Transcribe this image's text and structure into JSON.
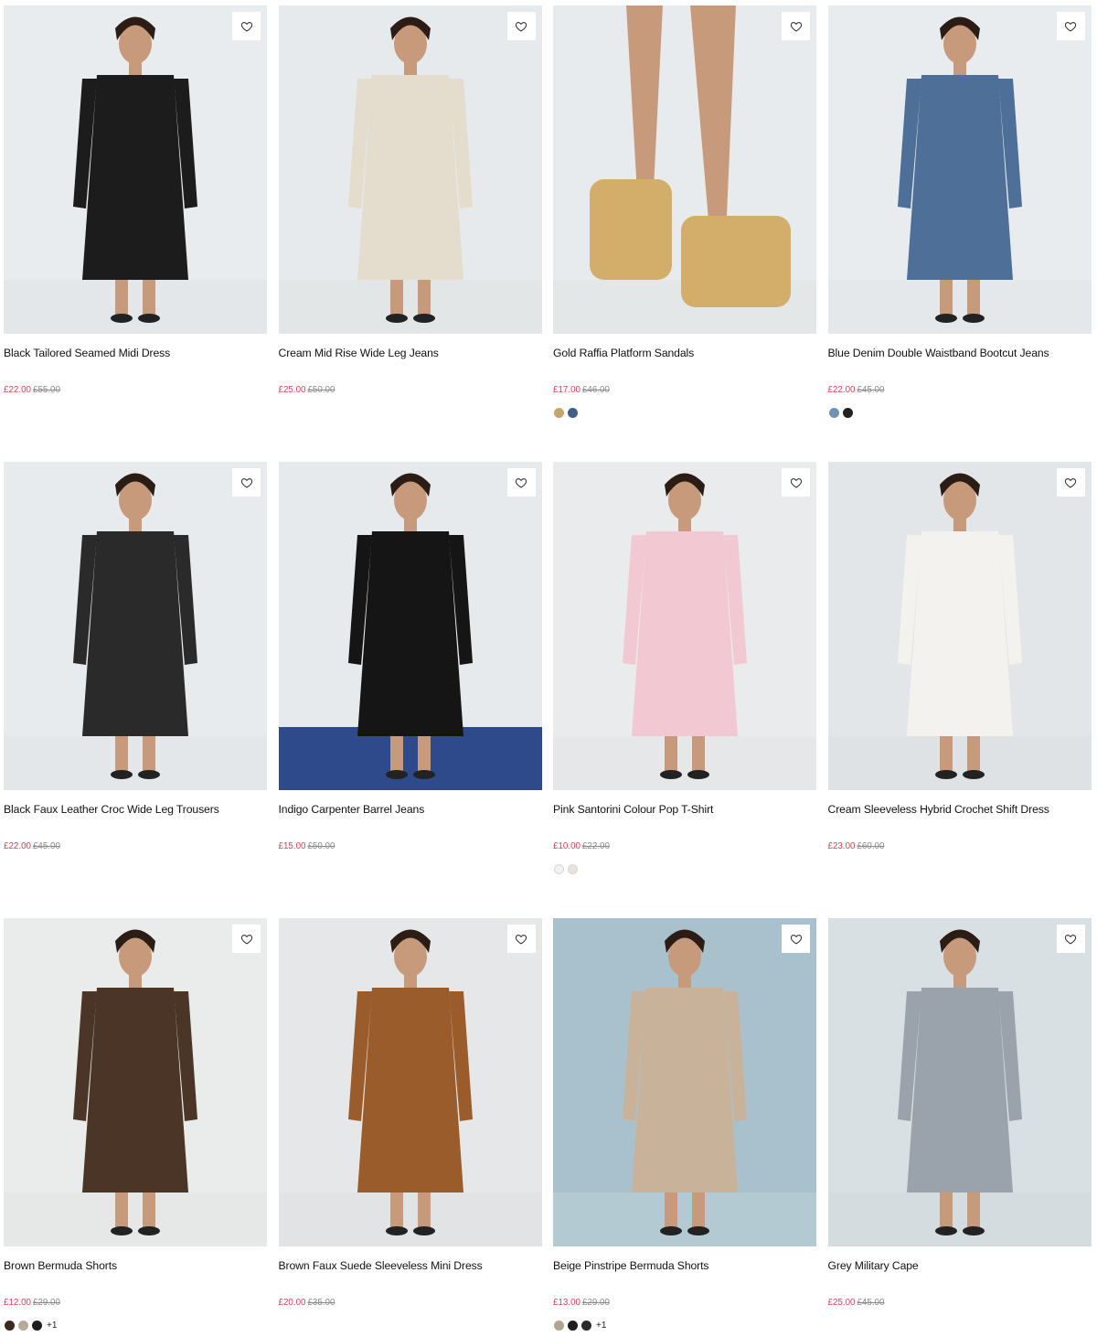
{
  "products": [
    {
      "title": "Black Tailored Seamed Midi Dress",
      "price": "£22.00",
      "was": "£55.00",
      "bg": "#e8ecee",
      "floor": "#e3e7e9",
      "tone": "#1c1c1c",
      "swatches": [],
      "more": ""
    },
    {
      "title": "Cream Mid Rise Wide Leg Jeans",
      "price": "£25.00",
      "was": "£50.00",
      "bg": "#e6eaec",
      "floor": "#e2e6e7",
      "tone": "#e4dccd",
      "swatches": [],
      "more": ""
    },
    {
      "title": "Gold Raffia Platform Sandals",
      "price": "£17.00",
      "was": "£46.00",
      "bg": "#e8ebed",
      "floor": "#e4e7e8",
      "tone": "#d3ad6a",
      "swatches": [
        "#c4a56e",
        "#3f6086"
      ],
      "more": ""
    },
    {
      "title": "Blue Denim Double Waistband Bootcut Jeans",
      "price": "£22.00",
      "was": "£45.00",
      "bg": "#e9ecee",
      "floor": "#e5e8ea",
      "tone": "#4d6f98",
      "swatches": [
        "#6f93b6",
        "#222222"
      ],
      "more": ""
    },
    {
      "title": "Black Faux Leather Croc Wide Leg Trousers",
      "price": "£22.00",
      "was": "£45.00",
      "bg": "#e7ebed",
      "floor": "#e3e7e9",
      "tone": "#2a2a2a",
      "swatches": [],
      "more": ""
    },
    {
      "title": "Indigo Carpenter Barrel Jeans",
      "price": "£15.00",
      "was": "£50.00",
      "bg": "#e7eaec",
      "floor": "#2f4a8a",
      "tone": "#151515",
      "swatches": [],
      "more": ""
    },
    {
      "title": "Pink Santorini Colour Pop T-Shirt",
      "price": "£10.00",
      "was": "£22.00",
      "bg": "#e9ebec",
      "floor": "#e5e7e8",
      "tone": "#f2c9d3",
      "swatches": [
        "#f2f2f2",
        "#e8e4dc"
      ],
      "more": ""
    },
    {
      "title": "Cream Sleeveless Hybrid Crochet Shift Dress",
      "price": "£23.00",
      "was": "£60.00",
      "bg": "#e3e6e9",
      "floor": "#dfe2e5",
      "tone": "#f3f2ee",
      "swatches": [],
      "more": ""
    },
    {
      "title": "Brown Bermuda Shorts",
      "price": "£12.00",
      "was": "£29.00",
      "bg": "#eaecec",
      "floor": "#e6e8e8",
      "tone": "#4a3526",
      "swatches": [
        "#3a2a1e",
        "#b8ab98",
        "#1e1e1e"
      ],
      "more": "+1"
    },
    {
      "title": "Brown Faux Suede Sleeveless Mini Dress",
      "price": "£20.00",
      "was": "£35.00",
      "bg": "#e6e7e8",
      "floor": "#e2e3e4",
      "tone": "#9b5c2c",
      "swatches": [],
      "more": ""
    },
    {
      "title": "Beige Pinstripe Bermuda Shorts",
      "price": "£13.00",
      "was": "£29.00",
      "bg": "#a9c1cc",
      "floor": "#b4cad3",
      "tone": "#c8b39a",
      "swatches": [
        "#b0a58e",
        "#1e1e1e",
        "#2b2b2b"
      ],
      "more": "+1"
    },
    {
      "title": "Grey Military Cape",
      "price": "£25.00",
      "was": "£45.00",
      "bg": "#d9e0e4",
      "floor": "#d5dce0",
      "tone": "#9aa3ab",
      "swatches": [],
      "more": ""
    }
  ],
  "icons": {
    "wishlist": "heart-outline-icon"
  }
}
